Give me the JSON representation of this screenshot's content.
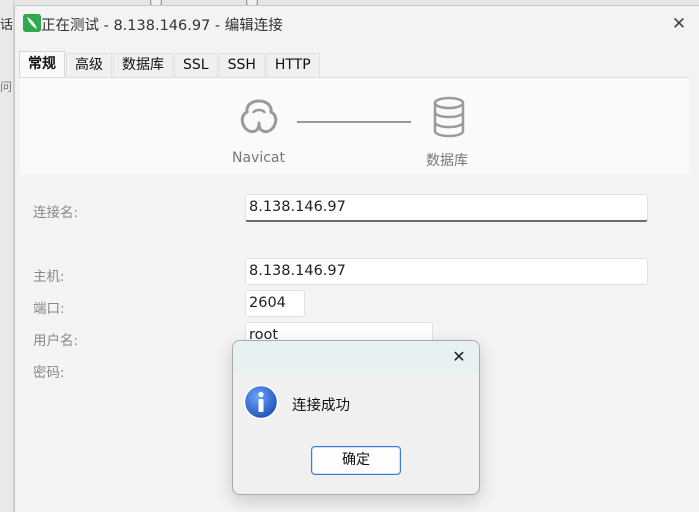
{
  "background": {
    "fragment_top": "话",
    "fragment_mid": "问"
  },
  "window": {
    "title": "正在测试 - 8.138.146.97 - 编辑连接",
    "close_glyph": "✕"
  },
  "tabs": [
    {
      "label": "常规",
      "active": true
    },
    {
      "label": "高级",
      "active": false
    },
    {
      "label": "数据库",
      "active": false
    },
    {
      "label": "SSL",
      "active": false
    },
    {
      "label": "SSH",
      "active": false
    },
    {
      "label": "HTTP",
      "active": false
    }
  ],
  "diagram": {
    "left_label": "Navicat",
    "right_label": "数据库",
    "left_icon": "navicat-logo-icon",
    "right_icon": "database-icon"
  },
  "form": {
    "connection_name_label": "连接名:",
    "connection_name_value": "8.138.146.97",
    "host_label": "主机:",
    "host_value": "8.138.146.97",
    "port_label": "端口:",
    "port_value": "2604",
    "username_label": "用户名:",
    "username_value": "root",
    "password_label": "密码:"
  },
  "message_box": {
    "close_glyph": "✕",
    "icon": "info-icon",
    "text": "连接成功",
    "ok_label": "确定"
  },
  "colors": {
    "accent": "#3a7bd5",
    "app_icon": "#2fa84f",
    "info_icon": "#1f56b8"
  }
}
